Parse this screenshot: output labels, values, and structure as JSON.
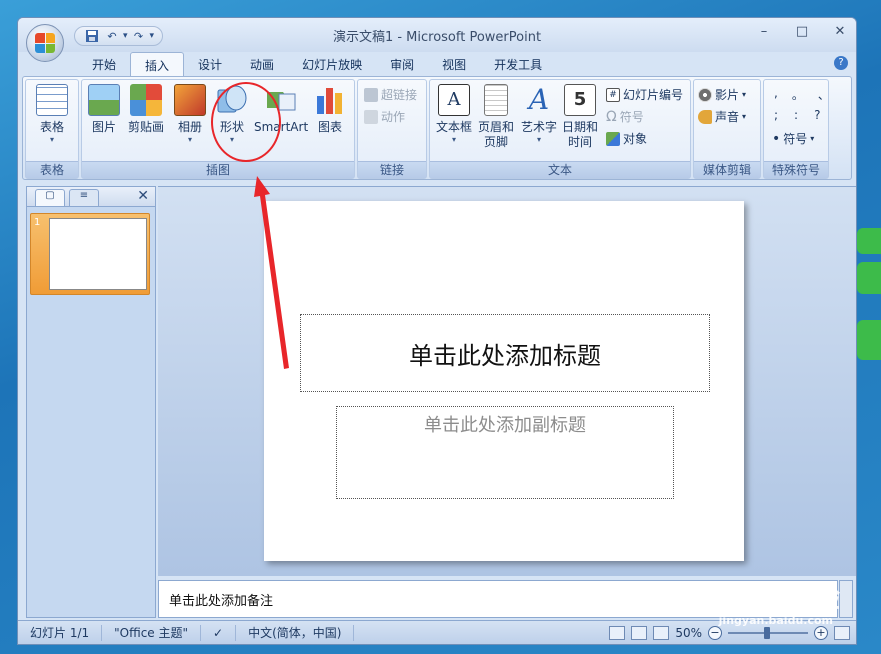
{
  "window": {
    "title": "演示文稿1 - Microsoft PowerPoint",
    "controls": [
      "–",
      "□",
      "✕"
    ]
  },
  "qat": {
    "more": "▾"
  },
  "tabs": [
    "开始",
    "插入",
    "设计",
    "动画",
    "幻灯片放映",
    "审阅",
    "视图",
    "开发工具"
  ],
  "active_tab": "插入",
  "ribbon": {
    "groups": {
      "table": {
        "label": "表格",
        "btn": "表格"
      },
      "illustrations": {
        "label": "插图",
        "picture": "图片",
        "clipart": "剪贴画",
        "album": "相册",
        "shapes": "形状",
        "smartart": "SmartArt",
        "chart": "图表"
      },
      "links": {
        "label": "链接",
        "hyperlink": "超链接",
        "action": "动作"
      },
      "text": {
        "label": "文本",
        "textbox": "文本框",
        "header_footer": "页眉和页脚",
        "wordart": "艺术字",
        "datetime": "日期和时间",
        "slide_number": "幻灯片编号",
        "symbol": "符号",
        "object": "对象",
        "calendar_digit": "5"
      },
      "media": {
        "label": "媒体剪辑",
        "movie": "影片",
        "sound": "声音"
      },
      "special": {
        "label": "特殊符号",
        "symbols_row1": [
          ",",
          "。",
          "、"
        ],
        "symbols_row2": [
          ";",
          ":",
          "?"
        ],
        "symbol_btn": "符号"
      }
    }
  },
  "left_pane": {
    "slide_number": "1",
    "close": "✕"
  },
  "slide": {
    "title_placeholder": "单击此处添加标题",
    "subtitle_placeholder": "单击此处添加副标题"
  },
  "notes": {
    "placeholder": "单击此处添加备注"
  },
  "status": {
    "slide_info": "幻灯片 1/1",
    "theme": "\"Office 主题\"",
    "language": "中文(简体，中国)",
    "zoom": "50%"
  },
  "watermark": {
    "brand": "Baidu经验",
    "url": "jingyan.baidu.com"
  },
  "colors": {
    "annotation": "#e8262a",
    "ribbon_bg": "#e1ebf8"
  }
}
